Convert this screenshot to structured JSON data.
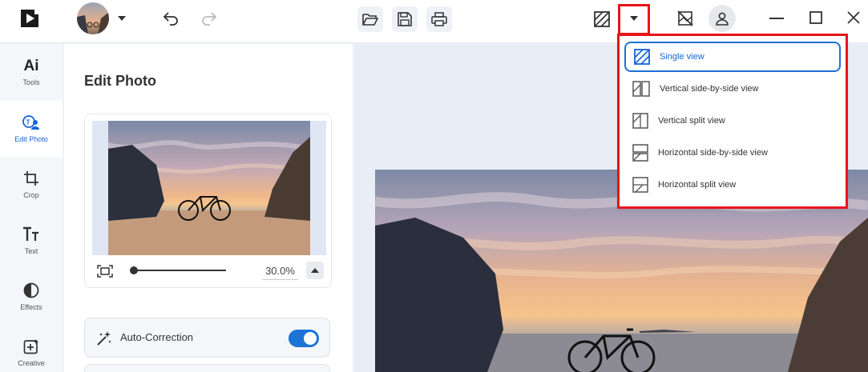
{
  "topbar": {
    "app_logo_icon": "app-logo-icon",
    "account_chevron": "chevron-down-icon",
    "undo_icon": "undo-icon",
    "redo_icon": "redo-icon",
    "open_icon": "folder-open-icon",
    "save_icon": "save-icon",
    "print_icon": "print-icon",
    "view_icon": "single-view-icon",
    "view_dropdown_icon": "caret-down-icon",
    "compare_off_icon": "compare-off-icon",
    "user_icon": "user-icon"
  },
  "rail": {
    "items": [
      {
        "label": "Tools",
        "icon": "ai-icon"
      },
      {
        "label": "Edit Photo",
        "icon": "edit-photo-icon",
        "active": true
      },
      {
        "label": "Crop",
        "icon": "crop-icon"
      },
      {
        "label": "Text",
        "icon": "text-icon"
      },
      {
        "label": "Effects",
        "icon": "effects-icon"
      },
      {
        "label": "Creative",
        "icon": "creative-icon"
      }
    ]
  },
  "panel": {
    "title": "Edit Photo",
    "zoom": "30.0%",
    "auto_correction_label": "Auto-Correction",
    "auto_correction_on": true
  },
  "view_menu": {
    "items": [
      {
        "label": "Single view",
        "icon": "single-view-icon",
        "selected": true
      },
      {
        "label": "Vertical side-by-side view",
        "icon": "vertical-side-by-side-icon"
      },
      {
        "label": "Vertical split view",
        "icon": "vertical-split-icon"
      },
      {
        "label": "Horizontal side-by-side view",
        "icon": "horizontal-side-by-side-icon"
      },
      {
        "label": "Horizontal split view",
        "icon": "horizontal-split-icon"
      }
    ]
  },
  "colors": {
    "accent": "#1565d8",
    "highlight_red": "#e8141a"
  }
}
